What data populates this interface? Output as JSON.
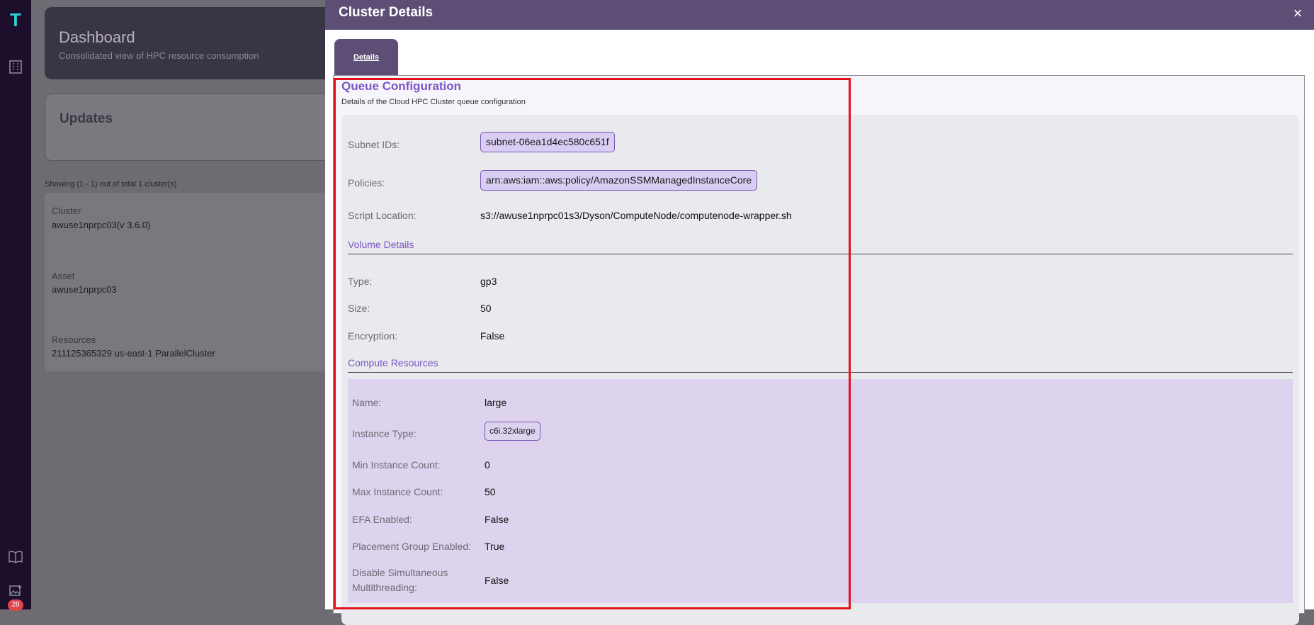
{
  "sidebar": {
    "logo": "T",
    "badge_count": "28",
    "icons": [
      "building-icon",
      "book-icon",
      "image-icon"
    ]
  },
  "background": {
    "dashboard_title": "Dashboard",
    "dashboard_subtitle": "Consolidated view of HPC resource consumption",
    "updates_title": "Updates",
    "showing_text": "Showing (1 - 1) out of total 1 cluster(s)",
    "cluster_label": "Cluster",
    "cluster_value": "awuse1nprpc03(v 3.6.0)",
    "asset_label": "Asset",
    "asset_value": "awuse1nprpc03",
    "resources_label": "Resources",
    "resources_value": "211125365329 us-east-1 ParallelCluster"
  },
  "modal": {
    "title": "Cluster Details",
    "close_icon": "×",
    "tab_label": "Details"
  },
  "queue": {
    "title": "Queue Configuration",
    "subtitle": "Details of the Cloud HPC Cluster queue configuration",
    "subnet_label": "Subnet IDs:",
    "subnet_value": "subnet-06ea1d4ec580c651f",
    "policies_label": "Policies:",
    "policies_value": "arn:aws:iam::aws:policy/AmazonSSMManagedInstanceCore",
    "script_label": "Script Location:",
    "script_value": "s3://awuse1nprpc01s3/Dyson/ComputeNode/computenode-wrapper.sh"
  },
  "volume": {
    "heading": "Volume Details",
    "type_label": "Type:",
    "type_value": "gp3",
    "size_label": "Size:",
    "size_value": "50",
    "encryption_label": "Encryption:",
    "encryption_value": "False"
  },
  "compute": {
    "heading": "Compute Resources",
    "name_label": "Name:",
    "name_value": "large",
    "instance_type_label": "Instance Type:",
    "instance_type_value": "c6i.32xlarge",
    "min_label": "Min Instance Count:",
    "min_value": "0",
    "max_label": "Max Instance Count:",
    "max_value": "50",
    "efa_label": "EFA Enabled:",
    "efa_value": "False",
    "placement_label": "Placement Group Enabled:",
    "placement_value": "True",
    "dsm_label_line1": "Disable Simultaneous",
    "dsm_label_line2": "Multithreading:",
    "dsm_value": "False"
  },
  "colors": {
    "accent": "#7b55c6",
    "header": "#5d4e75",
    "highlight": "#e3111b"
  }
}
